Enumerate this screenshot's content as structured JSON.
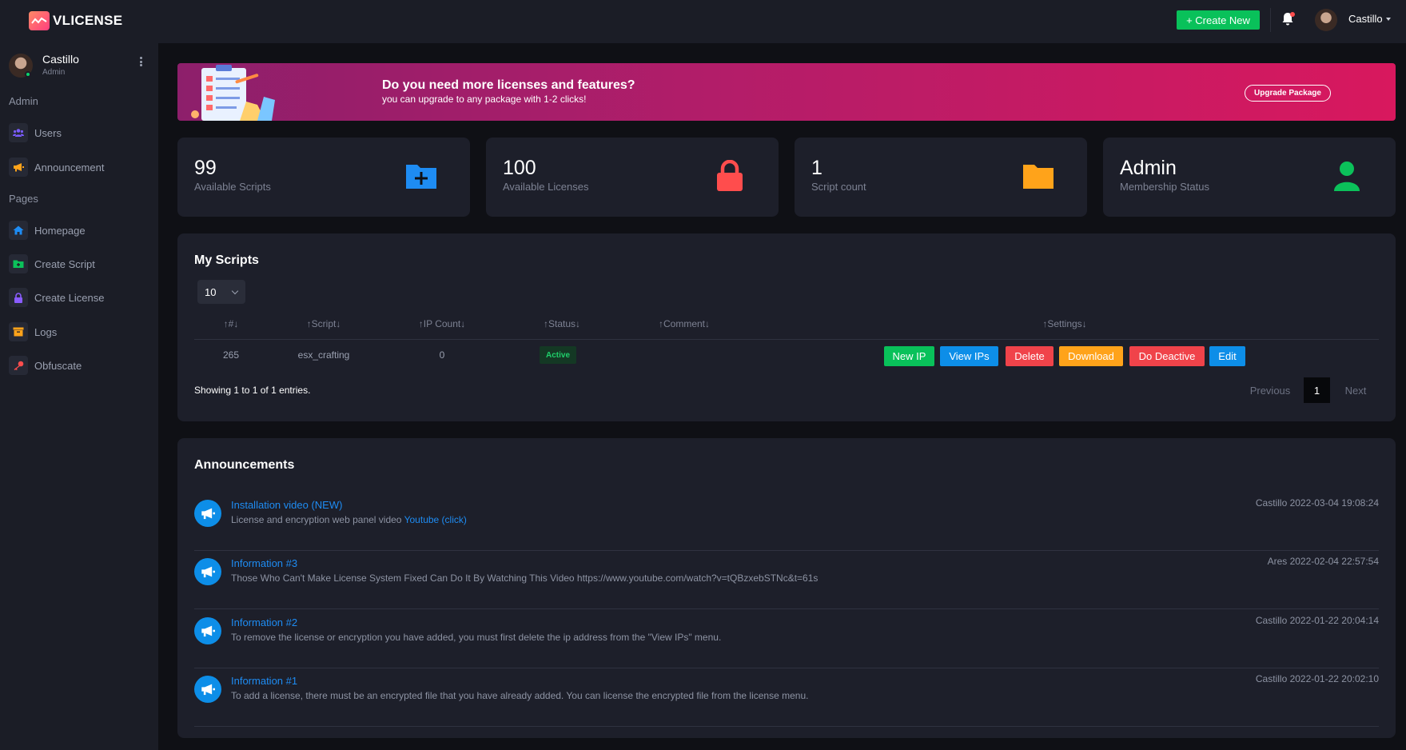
{
  "app": {
    "logo_text": "VLICENSE"
  },
  "topbar": {
    "create_label": "+ Create New",
    "user_name": "Castillo"
  },
  "sidebar": {
    "user": {
      "name": "Castillo",
      "role": "Admin"
    },
    "sections": [
      {
        "title": "Admin",
        "items": [
          {
            "label": "Users",
            "icon": "users-icon",
            "color": "#7b5cff"
          },
          {
            "label": "Announcement",
            "icon": "megaphone-icon",
            "color": "#ffa31a"
          }
        ]
      },
      {
        "title": "Pages",
        "items": [
          {
            "label": "Homepage",
            "icon": "home-icon",
            "color": "#1e8cf3"
          },
          {
            "label": "Create Script",
            "icon": "folder-plus-icon",
            "color": "#0bc15a"
          },
          {
            "label": "Create License",
            "icon": "lock-icon",
            "color": "#8a5cff"
          },
          {
            "label": "Logs",
            "icon": "archive-icon",
            "color": "#ffa31a"
          },
          {
            "label": "Obfuscate",
            "icon": "key-icon",
            "color": "#ff4d4d"
          }
        ]
      }
    ]
  },
  "banner": {
    "title": "Do you need more licenses and features?",
    "subtitle": "you can upgrade to any package with 1-2 clicks!",
    "button_label": "Upgrade Package"
  },
  "stats": [
    {
      "value": "99",
      "label": "Available Scripts",
      "icon": "folder-plus-icon",
      "color": "#1e8cf3"
    },
    {
      "value": "100",
      "label": "Available Licenses",
      "icon": "lock-icon",
      "color": "#ff4d4d"
    },
    {
      "value": "1",
      "label": "Script count",
      "icon": "folder-icon",
      "color": "#ffa31a"
    },
    {
      "value": "Admin",
      "label": "Membership Status",
      "icon": "user-icon",
      "color": "#0bc15a"
    }
  ],
  "scripts": {
    "title": "My Scripts",
    "page_length": "10",
    "columns": [
      "#",
      "Script",
      "IP Count",
      "Status",
      "Comment",
      "Settings"
    ],
    "rows": [
      {
        "id": "265",
        "script": "esx_crafting",
        "ip_count": "0",
        "status": "Active",
        "comment": ""
      }
    ],
    "actions": [
      {
        "label": "New IP",
        "color": "#09c15a"
      },
      {
        "label": "View IPs",
        "color": "#0d8ee8"
      },
      {
        "label": "Delete",
        "color": "#f0434a"
      },
      {
        "label": "Download",
        "color": "#ffa31a"
      },
      {
        "label": "Do Deactive",
        "color": "#f0434a"
      },
      {
        "label": "Edit",
        "color": "#0d8ee8"
      }
    ],
    "showing": "Showing 1 to 1 of 1 entries.",
    "pagination": {
      "previous": "Previous",
      "current": "1",
      "next": "Next"
    }
  },
  "announcements": {
    "title": "Announcements",
    "items": [
      {
        "title": "Installation video (NEW)",
        "body": "License and encryption web panel video ",
        "link": "Youtube (click)",
        "meta": "Castillo 2022-03-04 19:08:24"
      },
      {
        "title": "Information #3",
        "body": "Those Who Can't Make License System Fixed Can Do It By Watching This Video https://www.youtube.com/watch?v=tQBzxebSTNc&t=61s",
        "link": "",
        "meta": "Ares 2022-02-04 22:57:54"
      },
      {
        "title": "Information #2",
        "body": "To remove the license or encryption you have added, you must first delete the ip address from the \"View IPs\" menu.",
        "link": "",
        "meta": "Castillo 2022-01-22 20:04:14"
      },
      {
        "title": "Information #1",
        "body": "To add a license, there must be an encrypted file that you have already added. You can license the encrypted file from the license menu.",
        "link": "",
        "meta": "Castillo 2022-01-22 20:02:10"
      }
    ]
  }
}
